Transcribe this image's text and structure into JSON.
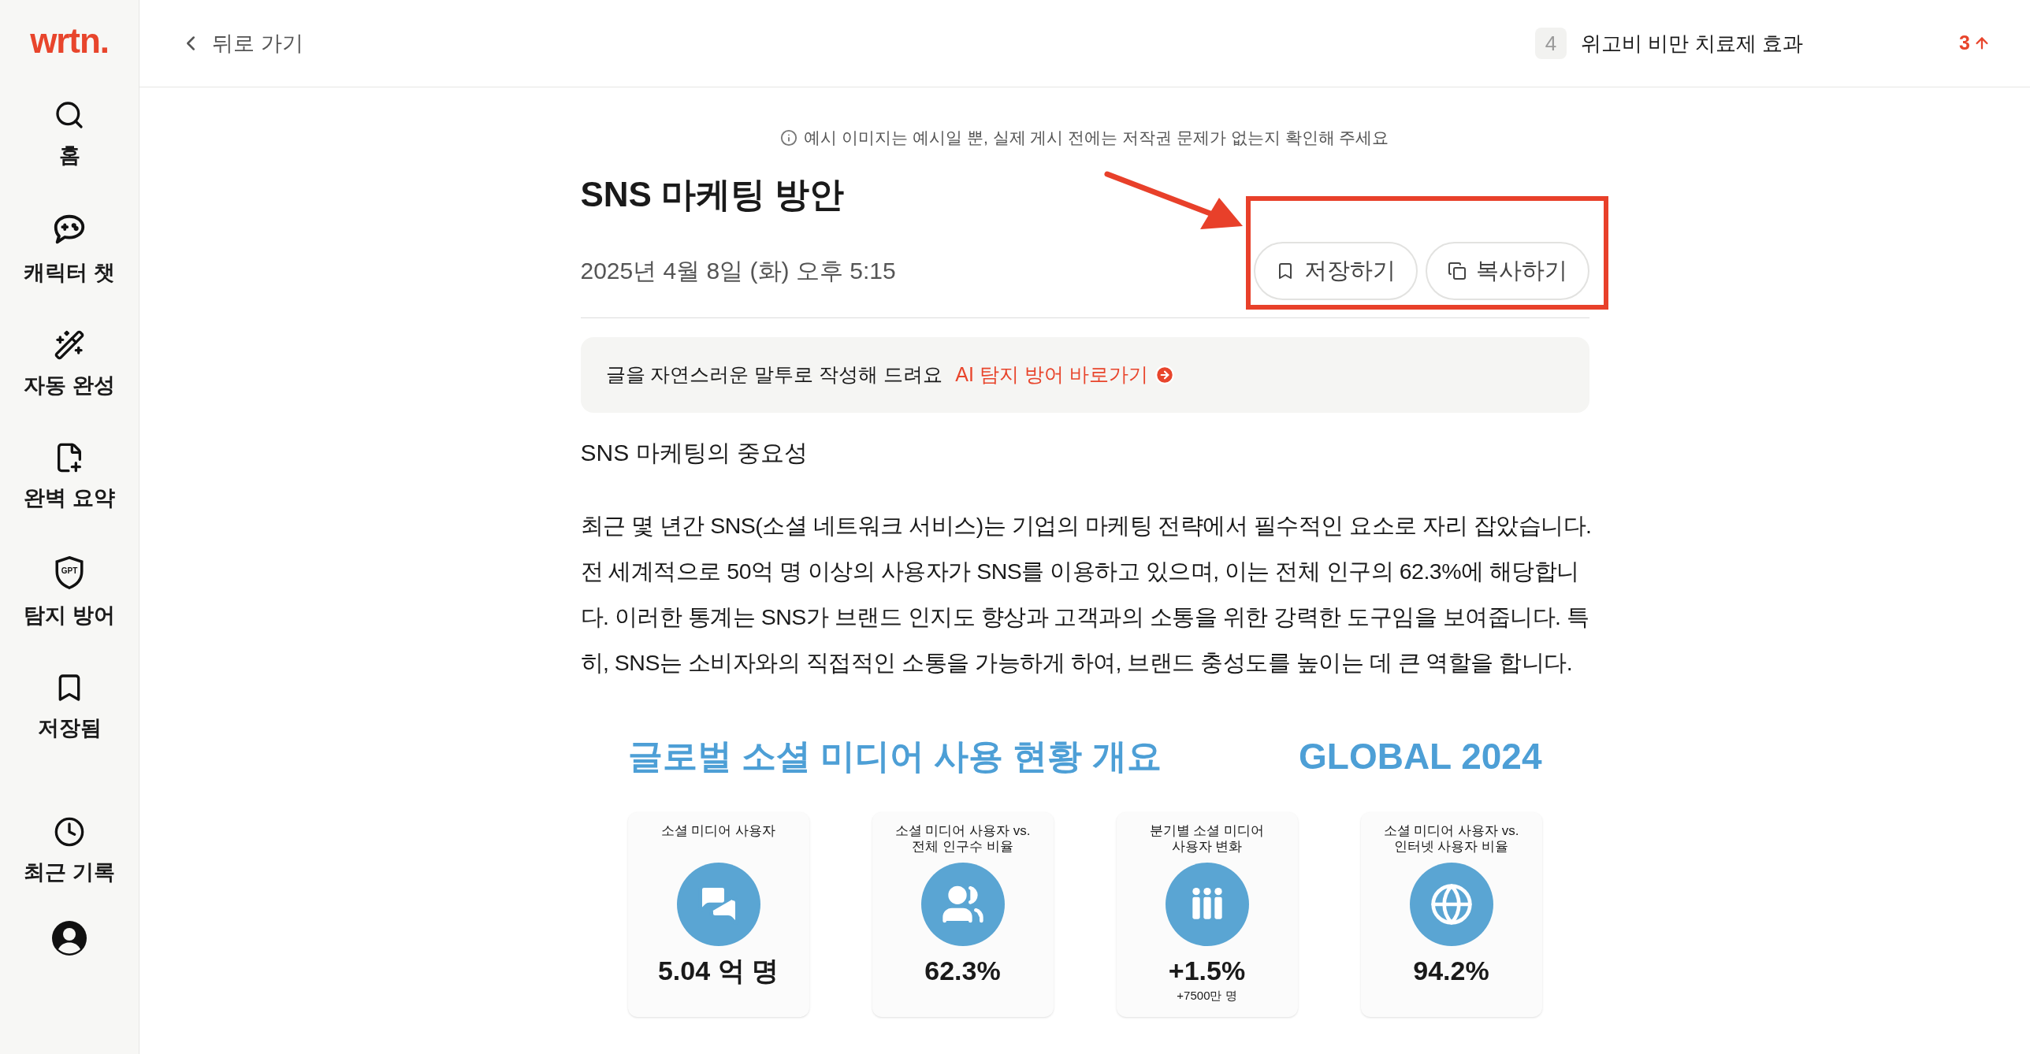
{
  "sidebar": {
    "logo": "wrtn.",
    "items": [
      {
        "label": "홈",
        "kind": "search"
      },
      {
        "label": "캐릭터 챗",
        "kind": "game-chat"
      },
      {
        "label": "자동 완성",
        "kind": "wand"
      },
      {
        "label": "완벽 요약",
        "kind": "summary"
      },
      {
        "label": "탐지 방어",
        "kind": "shield",
        "icon_text": "GPT"
      },
      {
        "label": "저장됨",
        "kind": "bookmark"
      },
      {
        "label": "최근 기록",
        "kind": "clock"
      }
    ],
    "profile": {
      "kind": "user"
    }
  },
  "header": {
    "back": "뒤로 가기",
    "trending": {
      "rank": "4",
      "title": "위고비 비만 치료제 효과",
      "change": "3",
      "rising": true
    }
  },
  "notice": "예시 이미지는 예시일 뿐, 실제 게시 전에는 저작권 문제가 없는지 확인해 주세요",
  "article": {
    "title": "SNS 마케팅 방안",
    "date": "2025년 4월 8일 (화) 오후 5:15",
    "actions": [
      {
        "label": "저장하기",
        "kind": "bookmark"
      },
      {
        "label": "복사하기",
        "kind": "copy"
      }
    ],
    "annotation": {
      "kind": "highlight-arrow"
    },
    "banner": {
      "text": "글을 자연스러운 말투로 작성해 드려요",
      "link": "AI 탐지 방어 바로가기"
    },
    "heading": "SNS 마케팅의 중요성",
    "paragraph": "최근 몇 년간 SNS(소셜 네트워크 서비스)는 기업의 마케팅 전략에서 필수적인 요소로 자리 잡았습니다. 전 세계적으로 50억 명 이상의 사용자가 SNS를 이용하고 있으며, 이는 전체 인구의 62.3%에 해당합니다. 이러한 통계는 SNS가 브랜드 인지도 향상과 고객과의 소통을 위한 강력한 도구임을 보여줍니다. 특히, SNS는 소비자와의 직접적인 소통을 가능하게 하여, 브랜드 충성도를 높이는 데 큰 역할을 합니다."
  },
  "infographic": {
    "title": "글로벌 소셜 미디어 사용 현황 개요",
    "tag": "GLOBAL 2024",
    "cards": [
      {
        "caption": "소셜 미디어 사용자",
        "kind": "chat",
        "value": "5.04 억 명"
      },
      {
        "caption": "소셜 미디어 사용자 vs.\n전체 인구수 비율",
        "kind": "group",
        "value": "62.3%"
      },
      {
        "caption": "분기별 소셜 미디어\n사용자 변화",
        "kind": "people",
        "value": "+1.5%",
        "note": "+7500만 명"
      },
      {
        "caption": "소셜 미디어 사용자 vs.\n인터넷 사용자 비율",
        "kind": "globe",
        "value": "94.2%"
      }
    ]
  }
}
